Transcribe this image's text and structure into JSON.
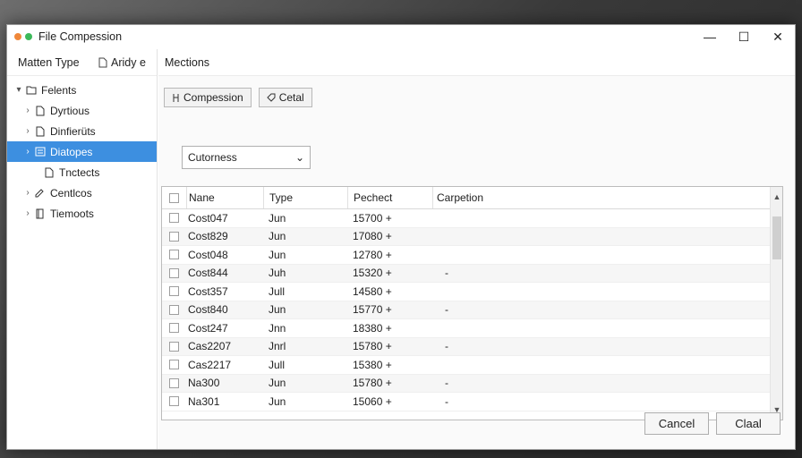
{
  "window": {
    "title": "File Compession",
    "controls": {
      "minimize": "—",
      "maximize": "☐",
      "close": "✕"
    }
  },
  "left_header": {
    "col1": "Matten Type",
    "col2": "Aridy e"
  },
  "tree": [
    {
      "label": "Felents",
      "expanded": true,
      "icon": "folder-icon",
      "indent": 0,
      "selected": false
    },
    {
      "label": "Dyrtious",
      "expanded": false,
      "icon": "document-icon",
      "indent": 1,
      "selected": false
    },
    {
      "label": "Dinfierüts",
      "expanded": false,
      "icon": "document-icon",
      "indent": 1,
      "selected": false
    },
    {
      "label": "Diatopes",
      "expanded": false,
      "icon": "list-icon",
      "indent": 1,
      "selected": true
    },
    {
      "label": "Tnctects",
      "expanded": null,
      "icon": "document-icon",
      "indent": 2,
      "selected": false
    },
    {
      "label": "Centlcos",
      "expanded": false,
      "icon": "edit-icon",
      "indent": 1,
      "selected": false
    },
    {
      "label": "Tiemoots",
      "expanded": false,
      "icon": "page-icon",
      "indent": 1,
      "selected": false
    }
  ],
  "right_header": {
    "title": "Mections"
  },
  "toolbar": {
    "compression_label": "Compession",
    "detail_label": "Cetal"
  },
  "filter_select": {
    "value": "Cutorness",
    "arrow": "⌄"
  },
  "table": {
    "columns": [
      "Nane",
      "Type",
      "Pechect",
      "Carpetion"
    ],
    "rows": [
      {
        "name": "Cost047",
        "type": "Jun",
        "pechect": "15700 +",
        "carpetion": ""
      },
      {
        "name": "Cost829",
        "type": "Jun",
        "pechect": "17080 +",
        "carpetion": ""
      },
      {
        "name": "Cost048",
        "type": "Jun",
        "pechect": "12780 +",
        "carpetion": ""
      },
      {
        "name": "Cost844",
        "type": "Juh",
        "pechect": "15320 +",
        "carpetion": "-"
      },
      {
        "name": "Cost357",
        "type": "Jull",
        "pechect": "14580 +",
        "carpetion": ""
      },
      {
        "name": "Cost840",
        "type": "Jun",
        "pechect": "15770 +",
        "carpetion": "-"
      },
      {
        "name": "Cost247",
        "type": "Jnn",
        "pechect": "18380 +",
        "carpetion": ""
      },
      {
        "name": "Cas2207",
        "type": "Jnrl",
        "pechect": "15780 +",
        "carpetion": "-"
      },
      {
        "name": "Cas2217",
        "type": "Jull",
        "pechect": "15380 +",
        "carpetion": ""
      },
      {
        "name": "Na300",
        "type": "Jun",
        "pechect": "15780 +",
        "carpetion": "-"
      },
      {
        "name": "Na301",
        "type": "Jun",
        "pechect": "15060 +",
        "carpetion": "-"
      }
    ]
  },
  "footer": {
    "cancel_label": "Cancel",
    "close_label": "Claal"
  },
  "colors": {
    "selection": "#3d8fe0",
    "dot_orange": "#f0883a",
    "dot_green": "#3cb95a"
  }
}
